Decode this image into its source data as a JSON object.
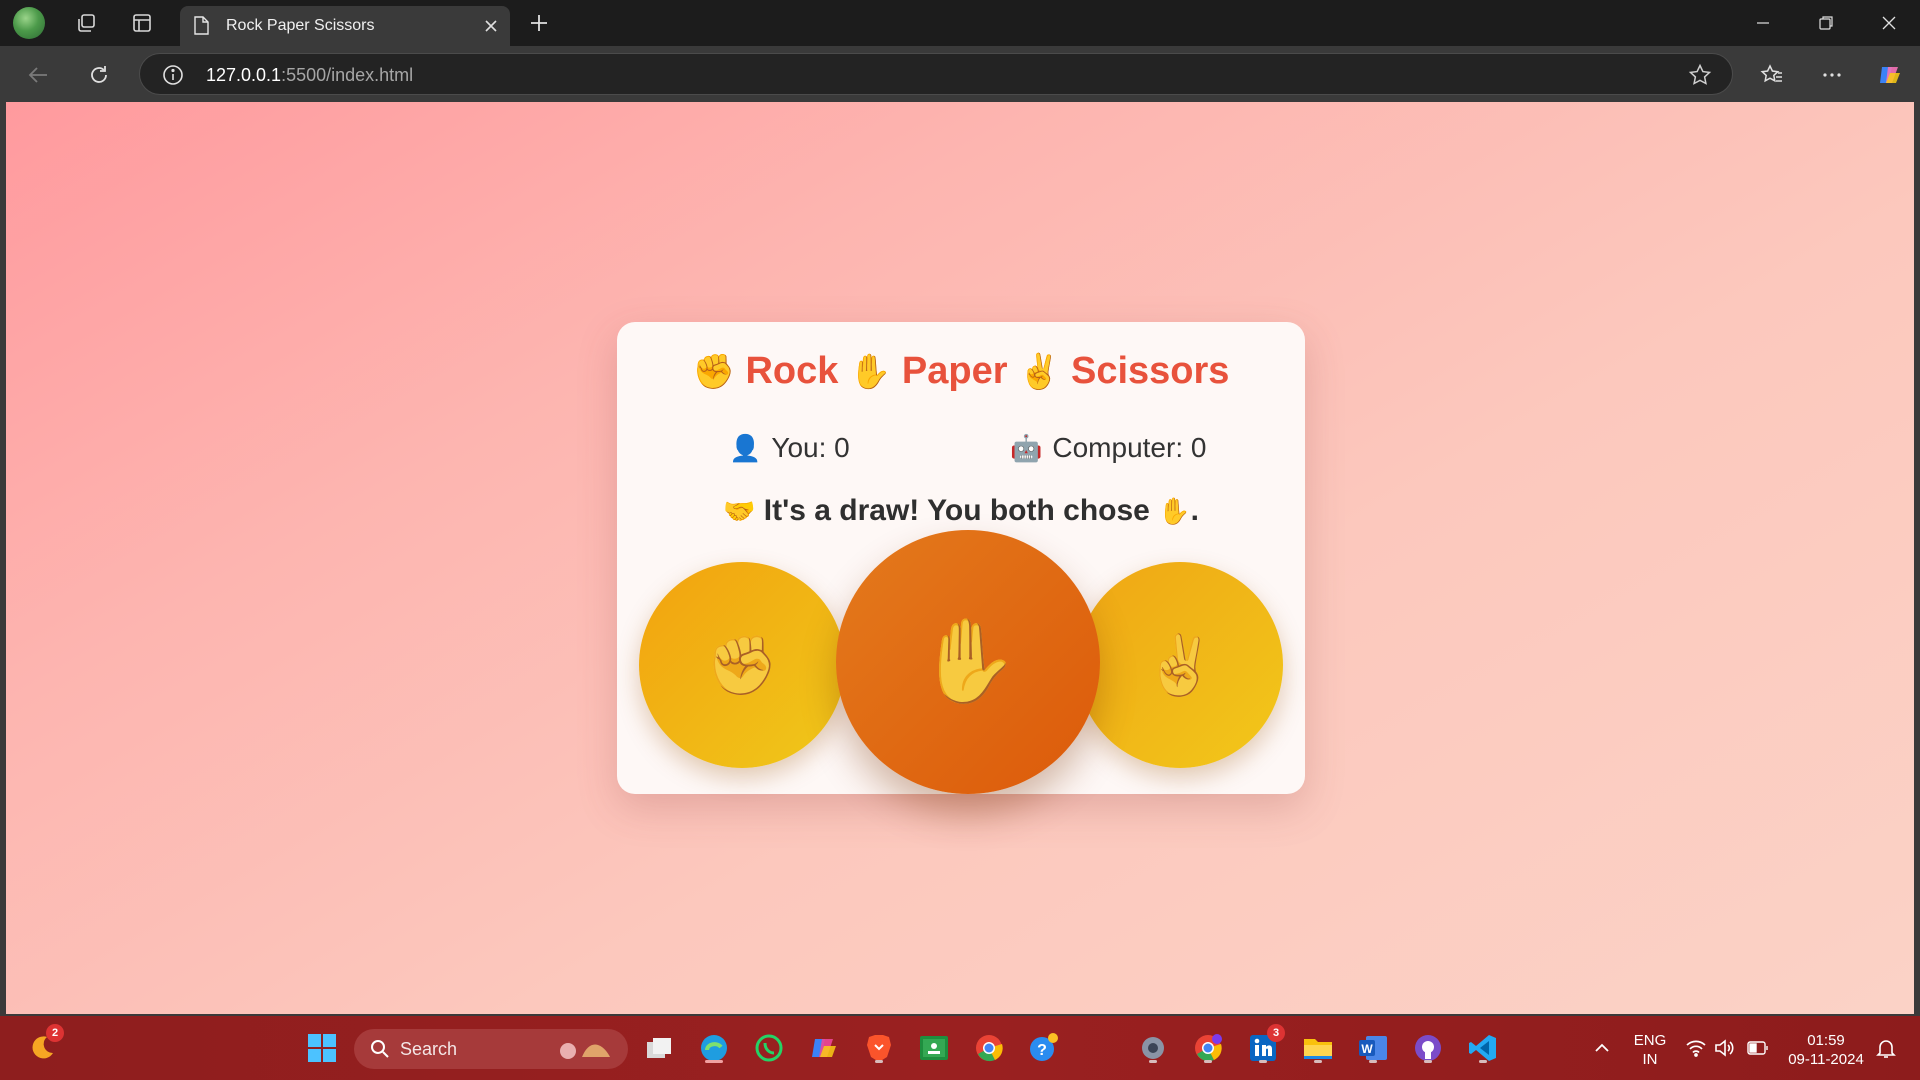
{
  "browser": {
    "tab_title": "Rock Paper Scissors",
    "url_host": "127.0.0.1",
    "url_rest": ":5500/index.html"
  },
  "game": {
    "title_rock": "Rock",
    "title_paper": "Paper",
    "title_scissors": "Scissors",
    "title_rock_emoji": "✊",
    "title_paper_emoji": "✋",
    "title_scissors_emoji": "✌️",
    "you_emoji": "👤",
    "you_label": "You: 0",
    "computer_emoji": "🤖",
    "computer_label": "Computer: 0",
    "result_emoji": "🤝",
    "result_text": "It's a draw! You both chose",
    "result_choice_emoji": "✋",
    "result_end": ".",
    "choices": {
      "rock": "✊",
      "paper": "✋",
      "scissors": "✌️"
    },
    "colors": {
      "title": "#e8523c",
      "rock_scissors": "#f2b012",
      "paper": "#df6a12"
    }
  },
  "taskbar": {
    "notification_count": "2",
    "search_label": "Search",
    "linkedin_badge": "3",
    "language": "ENG",
    "region": "IN",
    "time": "01:59",
    "date": "09-11-2024"
  }
}
